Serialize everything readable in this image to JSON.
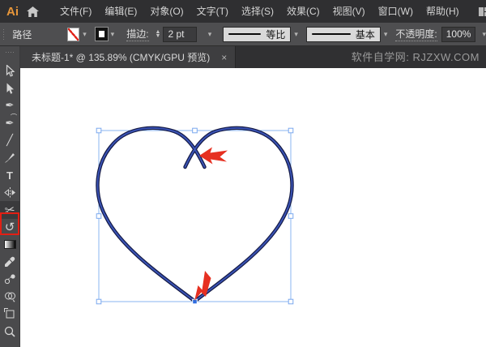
{
  "menu_bar": {
    "logo_text": "Ai",
    "items": [
      "文件(F)",
      "编辑(E)",
      "对象(O)",
      "文字(T)",
      "选择(S)",
      "效果(C)",
      "视图(V)",
      "窗口(W)",
      "帮助(H)"
    ]
  },
  "control_bar": {
    "context_label": "路径",
    "stroke_label": "描边:",
    "stroke_value": "2 pt",
    "variable_width_profile": "等比",
    "brush_definition": "基本",
    "opacity_label": "不透明度:",
    "opacity_value": "100%"
  },
  "tab_bar": {
    "document_title": "未标题-1* @ 135.89% (CMYK/GPU 预览)",
    "close_glyph": "×",
    "watermark": "软件自学网: RJZXW.COM"
  },
  "toolbar": {
    "tools": [
      "selection-tool",
      "direct-selection-tool",
      "pen-tool",
      "curvature-tool",
      "line-segment-tool",
      "paintbrush-tool",
      "type-tool",
      "reflect-tool",
      "scissors-tool",
      "rotate-tool",
      "gradient-tool",
      "eyedropper-tool",
      "blend-tool",
      "shape-builder-tool",
      "artboard-tool",
      "zoom-tool"
    ],
    "active_tool": "scissors-tool",
    "glyphs": {
      "pen": "✒",
      "curvature": "✒",
      "line": "╱",
      "type": "T",
      "scissors": "✂",
      "rotate": "↺"
    }
  },
  "canvas": {
    "shape": "open-heart-path",
    "heart_stroke_outer": "#141a45",
    "heart_stroke_inner": "#3a53b5",
    "selection_color": "#8ab4f0",
    "selected_anchor_color": "#2f6de0",
    "annotation_color": "#e63021"
  }
}
